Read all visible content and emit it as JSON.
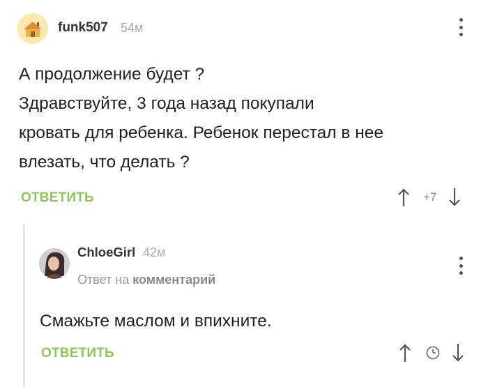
{
  "comment1": {
    "username": "funk507",
    "time": "54м",
    "lines": [
      "А продолжение будет ?",
      "Здравствуйте, 3 года назад покупали",
      "кровать для ребенка. Ребенок перестал в нее",
      "влезать, что делать ?"
    ],
    "reply_label": "ОТВЕТИТЬ",
    "rating": "+7",
    "avatar_icon": "house-avatar-icon"
  },
  "comment2": {
    "username": "ChloeGirl",
    "time": "42м",
    "reply_to_prefix": "Ответ на",
    "reply_to_link": "комментарий",
    "text": "Смажьте маслом и впихните.",
    "reply_label": "ОТВЕТИТЬ",
    "rating_icon": "clock-icon"
  },
  "colors": {
    "reply_green": "#8ac858",
    "time_gray": "#aaaaaa",
    "thread_line": "#e7e7e7"
  }
}
